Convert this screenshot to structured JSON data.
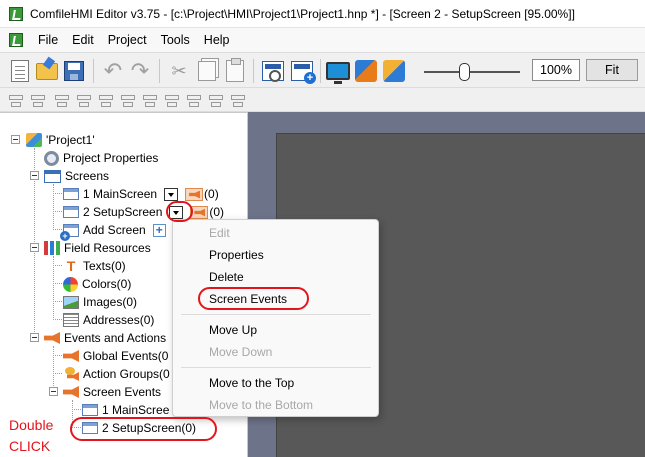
{
  "window": {
    "title": "ComfileHMI Editor v3.75 - [c:\\Project\\HMI\\Project1\\Project1.hnp *] - [Screen 2 - SetupScreen [95.00%]]"
  },
  "menu": [
    "File",
    "Edit",
    "Project",
    "Tools",
    "Help"
  ],
  "toolbar": {
    "zoom_label": "100%",
    "fit_label": "Fit",
    "zoom_slider_fraction": 0.41
  },
  "tree": {
    "project": "'Project1'",
    "project_properties": "Project Properties",
    "screens": "Screens",
    "screen1": "1 MainScreen",
    "screen1_count": "(0)",
    "screen2": "2 SetupScreen",
    "screen2_count": "(0)",
    "add_screen": "Add Screen",
    "field_resources": "Field Resources",
    "texts": "Texts(0)",
    "colors": "Colors(0)",
    "images": "Images(0)",
    "addresses": "Addresses(0)",
    "events_actions": "Events and Actions",
    "global_events": "Global Events(0",
    "action_groups": "Action Groups(0",
    "screen_events": "Screen Events",
    "se_screen1": "1 MainScree",
    "se_screen2": "2 SetupScreen(0)"
  },
  "context_menu": {
    "edit": "Edit",
    "properties": "Properties",
    "delete": "Delete",
    "screen_events": "Screen Events",
    "move_up": "Move Up",
    "move_down": "Move Down",
    "move_top": "Move to the Top",
    "move_bottom": "Move to the Bottom"
  },
  "annotation": {
    "line1": "Double",
    "line2": "CLICK"
  },
  "colors": {
    "annotation_red": "#e4141b",
    "canvas_bg": "#6d7389",
    "screen_bg": "#585858"
  }
}
